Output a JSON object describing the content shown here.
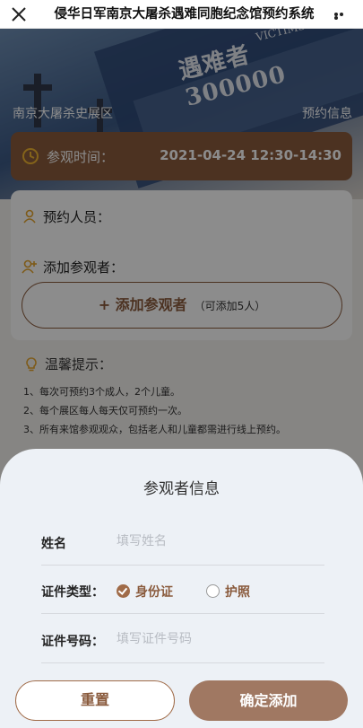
{
  "titlebar": {
    "title": "侵华日军南京大屠杀遇难同胞纪念馆预约系统",
    "close_icon": "close-icon",
    "more_icon": "more-icon"
  },
  "banner": {
    "number_text": "遇难者 300000",
    "english_text": "VICTIMS",
    "hall_name": "南京大屠杀史展区",
    "booking_info": "预约信息"
  },
  "visit": {
    "time_label": "参观时间：",
    "time_value": "2021-04-24 12:30-14:30"
  },
  "visitors": {
    "booker_label": "预约人员：",
    "add_label": "添加参观者：",
    "add_button": "+ 添加参观者",
    "add_hint": "（可添加5人）"
  },
  "tips": {
    "title": "温馨提示：",
    "lines": [
      "1、每次可预约3个成人，2个儿童。",
      "2、每个展区每人每天仅可预约一次。",
      "3、所有来馆参观观众，包括老人和儿童都需进行线上预约。"
    ]
  },
  "sheet": {
    "title": "参观者信息",
    "name_label": "姓名",
    "name_placeholder": "填写姓名",
    "id_type_label": "证件类型：",
    "id_type_options": [
      "身份证",
      "护照"
    ],
    "id_type_selected": "身份证",
    "id_number_label": "证件号码：",
    "id_number_placeholder": "填写证件号码",
    "reset_button": "重置",
    "confirm_button": "确定添加"
  },
  "colors": {
    "accent": "#8a5b3d",
    "confirm": "#a07862",
    "sheet_bg": "#edf1f6"
  }
}
